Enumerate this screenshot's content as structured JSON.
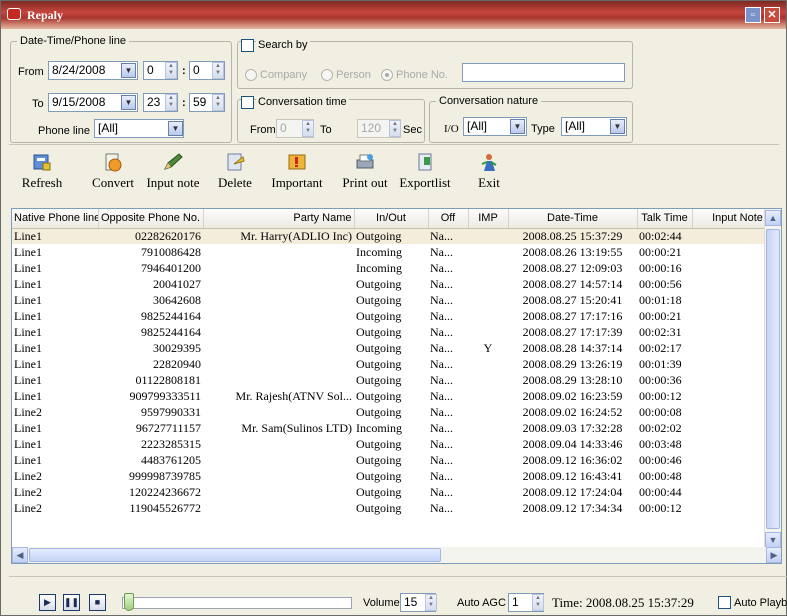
{
  "window": {
    "title": "Repaly"
  },
  "datetime_group": {
    "title": "Date-Time/Phone line",
    "from_label": "From",
    "from_date": "8/24/2008",
    "from_hour": "0",
    "from_min": "0",
    "to_label": "To",
    "to_date": "9/15/2008",
    "to_hour": "23",
    "to_min": "59",
    "phone_line_label": "Phone line",
    "phone_line_value": "[All]",
    "colon": ":"
  },
  "search_group": {
    "title": "Search by",
    "options": [
      "Company",
      "Person",
      "Phone No."
    ],
    "selected": "Phone No.",
    "text": ""
  },
  "conversation_time": {
    "title": "Conversation time",
    "from_label": "From",
    "from_value": "0",
    "to_label": "To",
    "to_value": "120",
    "unit": "Sec"
  },
  "conversation_nature": {
    "title": "Conversation nature",
    "io_label": "I/O",
    "io_value": "[All]",
    "type_label": "Type",
    "type_value": "[All]"
  },
  "toolbar": {
    "refresh": "Refresh",
    "convert": "Convert",
    "input_note": "Input note",
    "delete": "Delete",
    "important": "Important",
    "print_out": "Print out",
    "export_list": "Exportlist",
    "exit": "Exit"
  },
  "table": {
    "columns": [
      "Native Phone line",
      "Opposite Phone No.",
      "Party Name",
      "In/Out",
      "Off",
      "IMP",
      "Date-Time",
      "Talk Time",
      "Input Note"
    ],
    "rows": [
      [
        "Line1",
        "02282620176",
        "Mr. Harry(ADLIO Inc)",
        "Outgoing",
        "Na...",
        "",
        "2008.08.25 15:37:29",
        "00:02:44",
        ""
      ],
      [
        "Line1",
        "7910086428",
        "",
        "Incoming",
        "Na...",
        "",
        "2008.08.26 13:19:55",
        "00:00:21",
        ""
      ],
      [
        "Line1",
        "7946401200",
        "",
        "Incoming",
        "Na...",
        "",
        "2008.08.27 12:09:03",
        "00:00:16",
        ""
      ],
      [
        "Line1",
        "20041027",
        "",
        "Outgoing",
        "Na...",
        "",
        "2008.08.27 14:57:14",
        "00:00:56",
        ""
      ],
      [
        "Line1",
        "30642608",
        "",
        "Outgoing",
        "Na...",
        "",
        "2008.08.27 15:20:41",
        "00:01:18",
        ""
      ],
      [
        "Line1",
        "9825244164",
        "",
        "Outgoing",
        "Na...",
        "",
        "2008.08.27 17:17:16",
        "00:00:21",
        ""
      ],
      [
        "Line1",
        "9825244164",
        "",
        "Outgoing",
        "Na...",
        "",
        "2008.08.27 17:17:39",
        "00:02:31",
        ""
      ],
      [
        "Line1",
        "30029395",
        "",
        "Outgoing",
        "Na...",
        "Y",
        "2008.08.28 14:37:14",
        "00:02:17",
        ""
      ],
      [
        "Line1",
        "22820940",
        "",
        "Outgoing",
        "Na...",
        "",
        "2008.08.29 13:26:19",
        "00:01:39",
        ""
      ],
      [
        "Line1",
        "01122808181",
        "",
        "Outgoing",
        "Na...",
        "",
        "2008.08.29 13:28:10",
        "00:00:36",
        ""
      ],
      [
        "Line1",
        "909799333511",
        "Mr. Rajesh(ATNV Sol...",
        "Outgoing",
        "Na...",
        "",
        "2008.09.02 16:23:59",
        "00:00:12",
        ""
      ],
      [
        "Line2",
        "9597990331",
        "",
        "Outgoing",
        "Na...",
        "",
        "2008.09.02 16:24:52",
        "00:00:08",
        ""
      ],
      [
        "Line1",
        "96727711157",
        "Mr. Sam(Sulinos LTD)",
        "Incoming",
        "Na...",
        "",
        "2008.09.03 17:32:28",
        "00:02:02",
        ""
      ],
      [
        "Line1",
        "2223285315",
        "",
        "Outgoing",
        "Na...",
        "",
        "2008.09.04 14:33:46",
        "00:03:48",
        ""
      ],
      [
        "Line1",
        "4483761205",
        "",
        "Outgoing",
        "Na...",
        "",
        "2008.09.12 16:36:02",
        "00:00:46",
        ""
      ],
      [
        "Line2",
        "999998739785",
        "",
        "Outgoing",
        "Na...",
        "",
        "2008.09.12 16:43:41",
        "00:00:48",
        ""
      ],
      [
        "Line2",
        "120224236672",
        "",
        "Outgoing",
        "Na...",
        "",
        "2008.09.12 17:24:04",
        "00:00:44",
        ""
      ],
      [
        "Line2",
        "119045526772",
        "",
        "Outgoing",
        "Na...",
        "",
        "2008.09.12 17:34:34",
        "00:00:12",
        ""
      ]
    ]
  },
  "player": {
    "volume_label": "Volume",
    "volume_value": "15",
    "agc_label": "Auto AGC",
    "agc_value": "1",
    "time_text": "Time: 2008.08.25 15:37:29",
    "autoplay_label": "Auto Playba",
    "position": 0.0
  },
  "colors": {
    "title_bar": "#c7453d",
    "selected_row": "#f4eddc",
    "accent": "#7f9db9"
  }
}
